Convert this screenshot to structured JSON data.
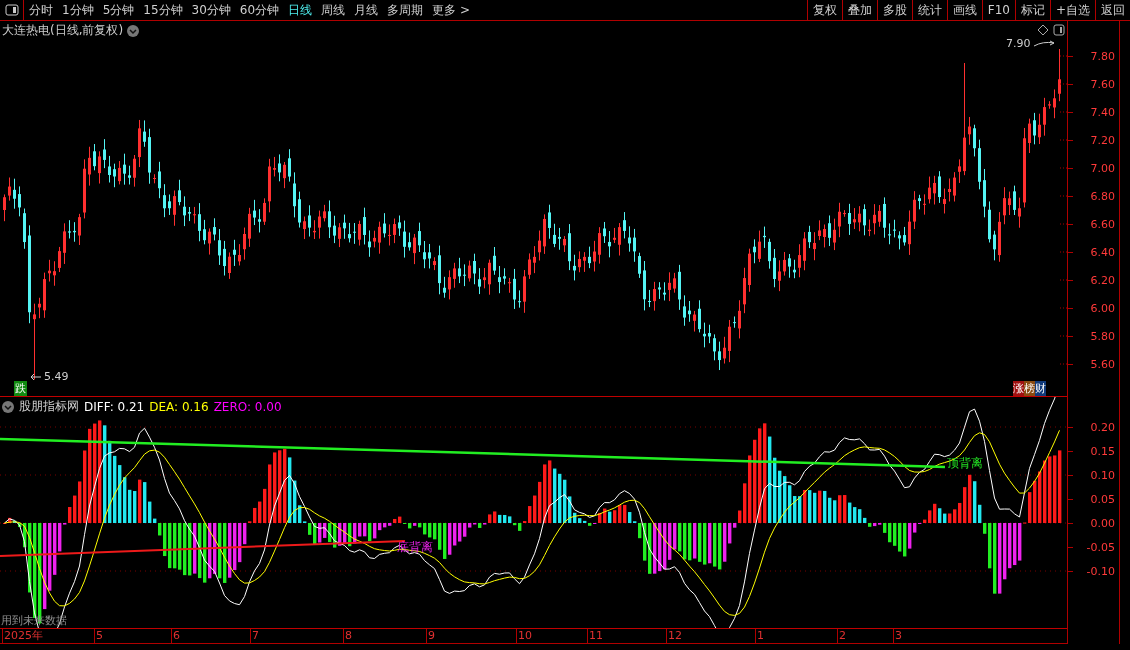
{
  "toolbar": {
    "periods": [
      {
        "label": "分时",
        "selected": false
      },
      {
        "label": "1分钟",
        "selected": false
      },
      {
        "label": "5分钟",
        "selected": false
      },
      {
        "label": "15分钟",
        "selected": false
      },
      {
        "label": "30分钟",
        "selected": false
      },
      {
        "label": "60分钟",
        "selected": false
      },
      {
        "label": "日线",
        "selected": true
      },
      {
        "label": "周线",
        "selected": false
      },
      {
        "label": "月线",
        "selected": false
      },
      {
        "label": "多周期",
        "selected": false
      },
      {
        "label": "更多 >",
        "selected": false
      }
    ],
    "actions": [
      "复权",
      "叠加",
      "多股",
      "统计",
      "画线",
      "F10",
      "标记",
      "+自选",
      "返回"
    ]
  },
  "price_panel": {
    "title": "大连热电(日线,前复权)",
    "high_label": "7.90",
    "low_label": "5.49",
    "signal_badge": "跌",
    "rank_badge": "涨榜财",
    "y_axis": [
      "7.80",
      "7.60",
      "7.40",
      "7.20",
      "7.00",
      "6.80",
      "6.60",
      "6.40",
      "6.20",
      "6.00",
      "5.80",
      "5.60"
    ]
  },
  "indicator_panel": {
    "name": "股朋指标网",
    "readings": [
      {
        "label": "DIFF: 0.21",
        "color": "#ffffff"
      },
      {
        "label": "DEA: 0.16",
        "color": "#ffff00"
      },
      {
        "label": "ZERO: 0.00",
        "color": "#ff00ff"
      }
    ],
    "annotations": [
      {
        "text": "顶背离",
        "kind": "top"
      },
      {
        "text": "底背离",
        "kind": "bottom"
      }
    ],
    "y_axis": [
      "0.20",
      "0.15",
      "0.10",
      "0.05",
      "0.00",
      "-0.05",
      "-0.10"
    ],
    "warning": "用到未来数据"
  },
  "time_axis": [
    "2025年",
    "5",
    "6",
    "7",
    "8",
    "9",
    "10",
    "11",
    "12",
    "1",
    "2",
    "3"
  ]
}
